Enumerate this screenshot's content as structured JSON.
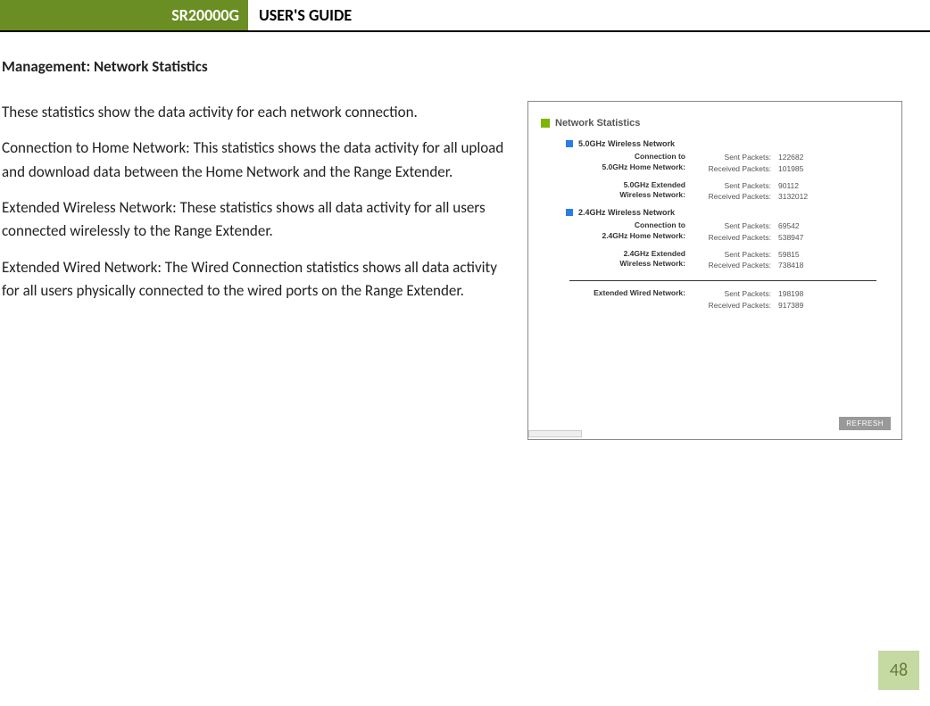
{
  "header": {
    "model": "SR20000G",
    "guide": "USER'S GUIDE"
  },
  "section_title": "Management: Network Statistics",
  "paragraphs": {
    "p1": "These statistics show the data activity for each network connection.",
    "p2": "Connection to Home Network: This statistics shows the data activity for all upload and download data between the Home Network and the Range Extender.",
    "p3": "Extended Wireless Network: These statistics shows all data activity for all users connected wirelessly to the Range Extender.",
    "p4": "Extended Wired Network: The Wired Connection statistics shows all data activity for all users physically connected to the wired ports on the Range Extender."
  },
  "panel": {
    "title": "Network Statistics",
    "section5": "5.0GHz Wireless Network",
    "section24": "2.4GHz Wireless Network",
    "sent_label": "Sent Packets:",
    "recv_label": "Received Packets:",
    "block5_home": {
      "title_l1": "Connection to",
      "title_l2": "5.0GHz Home Network:",
      "sent": "122682",
      "recv": "101985"
    },
    "block5_ext": {
      "title_l1": "5.0GHz Extended",
      "title_l2": "Wireless Network:",
      "sent": "90112",
      "recv": "3132012"
    },
    "block24_home": {
      "title_l1": "Connection to",
      "title_l2": "2.4GHz Home Network:",
      "sent": "69542",
      "recv": "538947"
    },
    "block24_ext": {
      "title_l1": "2.4GHz Extended",
      "title_l2": "Wireless Network:",
      "sent": "59815",
      "recv": "738418"
    },
    "block_wired": {
      "title": "Extended Wired Network:",
      "sent": "198198",
      "recv": "917389"
    },
    "refresh": "REFRESH"
  },
  "page_number": "48"
}
